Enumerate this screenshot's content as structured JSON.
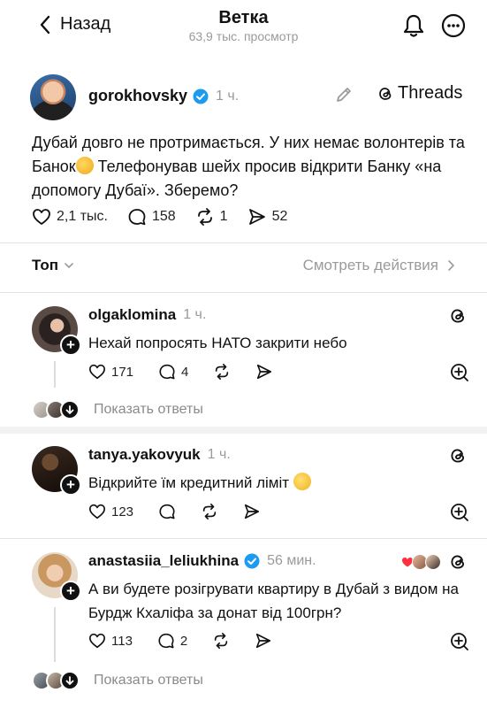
{
  "header": {
    "back_label": "Назад",
    "title": "Ветка",
    "views": "63,9 тыс. просмотр"
  },
  "post": {
    "username": "gorokhovsky",
    "time": "1 ч.",
    "threads_label": "Threads",
    "text_before_emoji": "Дубай довго не протримається. У них немає волонтерів та Банок",
    "text_after_emoji": " Телефонував шейх просив відкрити Банку «на допомогу Дубаї». Зберемо?",
    "likes": "2,1 тыс.",
    "comments": "158",
    "reposts": "1",
    "shares": "52"
  },
  "sort": {
    "top_label": "Топ",
    "activity_label": "Смотреть действия"
  },
  "comments": [
    {
      "username": "olgaklomina",
      "time": "1 ч.",
      "text": "Нехай попросять НАТО закрити небо",
      "likes": "171",
      "replies": "4",
      "show_replies": "Показать ответы"
    },
    {
      "username": "tanya.yakovyuk",
      "time": "1 ч.",
      "text": "Відкрийте їм кредитний ліміт",
      "likes": "123"
    },
    {
      "username": "anastasiia_leliukhina",
      "time": "56 мин.",
      "text": "А ви будете розігрувати квартиру в Дубай з видом на Бурдж Кхаліфа за донат від 100грн?",
      "likes": "113",
      "replies": "2",
      "show_replies": "Показать ответы"
    }
  ],
  "colors": {
    "verified": "#1d9bf0",
    "muted": "#9a9a9a",
    "text": "#111111"
  },
  "icons": [
    "chevron-left-icon",
    "bell-icon",
    "more-icon",
    "pencil-icon",
    "threads-icon",
    "heart-icon",
    "comment-icon",
    "repost-icon",
    "share-icon",
    "add-icon",
    "chevron-down-icon",
    "chevron-right-icon"
  ]
}
